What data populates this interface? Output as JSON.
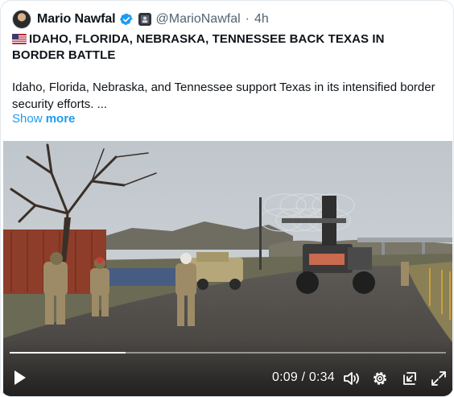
{
  "tweet": {
    "author_name": "Mario Nawfal",
    "handle": "@MarioNawfal",
    "separator": "·",
    "time_ago": "4h",
    "headline": "IDAHO, FLORIDA, NEBRASKA, TENNESSEE BACK TEXAS IN BORDER BATTLE",
    "body": "Idaho, Florida, Nebraska, and Tennessee support Texas in its intensified border security efforts. ...",
    "show_label": "Show",
    "more_label": "more"
  },
  "video": {
    "current_time": "0:09",
    "time_separator": "/",
    "duration": "0:34",
    "progress_fraction": 0.265,
    "icons": [
      "play-icon",
      "volume-icon",
      "settings-icon",
      "minimize-player-icon",
      "fullscreen-icon"
    ]
  },
  "colors": {
    "link": "#1d9bf0",
    "verified": "#1d9bf0",
    "secondary_text": "#536471"
  }
}
